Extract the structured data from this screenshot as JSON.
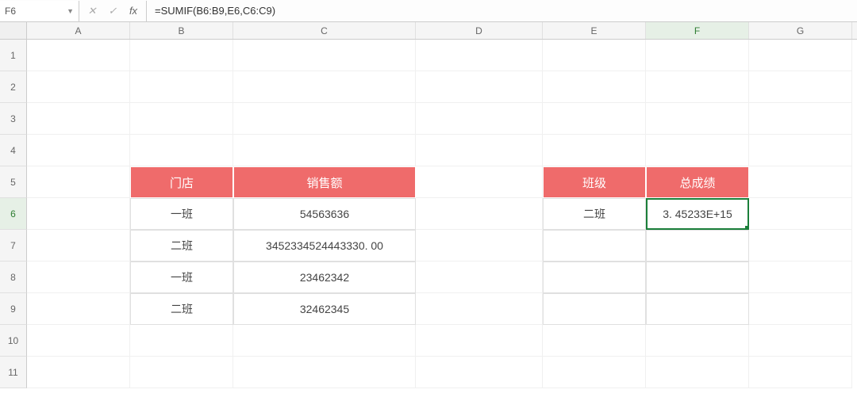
{
  "formula_bar": {
    "name_box": "F6",
    "formula": "=SUMIF(B6:B9,E6,C6:C9)",
    "cancel_symbol": "✕",
    "confirm_symbol": "✓",
    "fx_symbol": "fx"
  },
  "columns": [
    "A",
    "B",
    "C",
    "D",
    "E",
    "F",
    "G"
  ],
  "active_column": "F",
  "rows": [
    "1",
    "2",
    "3",
    "4",
    "5",
    "6",
    "7",
    "8",
    "9",
    "10",
    "11"
  ],
  "active_row": "6",
  "table1": {
    "header": {
      "col1": "门店",
      "col2": "销售额"
    },
    "data": [
      {
        "col1": "一班",
        "col2": "54563636"
      },
      {
        "col1": "二班",
        "col2": "3452334524443330. 00"
      },
      {
        "col1": "一班",
        "col2": "23462342"
      },
      {
        "col1": "二班",
        "col2": "32462345"
      }
    ]
  },
  "table2": {
    "header": {
      "col1": "班级",
      "col2": "总成绩"
    },
    "data": [
      {
        "col1": "二班",
        "col2": "3. 45233E+15"
      }
    ]
  }
}
